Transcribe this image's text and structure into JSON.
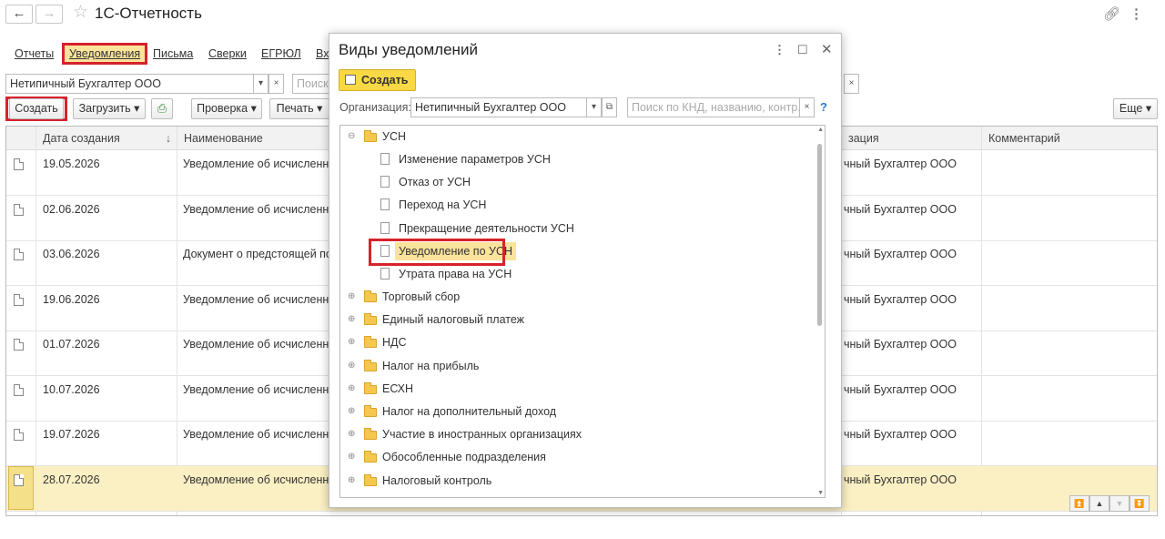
{
  "window": {
    "title": "1С-Отчетность",
    "back_icon": "←",
    "forward_icon": "→"
  },
  "tabs": [
    "Отчеты",
    "Уведомления",
    "Письма",
    "Сверки",
    "ЕГРЮЛ",
    "Вх"
  ],
  "filter": {
    "organization": "Нетипичный Бухгалтер ООО",
    "search_placeholder": "Поиск"
  },
  "toolbar": {
    "create": "Создать",
    "load": "Загрузить",
    "check": "Проверка",
    "print": "Печать",
    "more": "Еще"
  },
  "table": {
    "columns": [
      "Дата создания",
      "Наименование",
      "зация",
      "Комментарий"
    ],
    "rows": [
      {
        "date": "19.05.2026",
        "name": "Уведомление об исчисленных",
        "org": "чный Бухгалтер ООО"
      },
      {
        "date": "02.06.2026",
        "name": "Уведомление об исчисленных",
        "org": "чный Бухгалтер ООО"
      },
      {
        "date": "03.06.2026",
        "name": "Документ о предстоящей пост",
        "org": "чный Бухгалтер ООО"
      },
      {
        "date": "19.06.2026",
        "name": "Уведомление об исчисленных",
        "org": "чный Бухгалтер ООО"
      },
      {
        "date": "01.07.2026",
        "name": "Уведомление об исчисленных",
        "org": "чный Бухгалтер ООО"
      },
      {
        "date": "10.07.2026",
        "name": "Уведомление об исчисленных",
        "org": "чный Бухгалтер ООО"
      },
      {
        "date": "19.07.2026",
        "name": "Уведомление об исчисленных",
        "org": "чный Бухгалтер ООО"
      },
      {
        "date": "28.07.2026",
        "name": "Уведомление об исчисленных",
        "org": "чный Бухгалтер ООО"
      }
    ]
  },
  "modal": {
    "title": "Виды уведомлений",
    "create": "Создать",
    "org_label": "Организация:",
    "org_value": "Нетипичный Бухгалтер ООО",
    "search_placeholder": "Поиск по КНД, названию, контр...",
    "help": "?",
    "tree": {
      "usn": "УСН",
      "usn_children": [
        "Изменение параметров УСН",
        "Отказ от УСН",
        "Переход на УСН",
        "Прекращение деятельности УСН",
        "Уведомление по УСН",
        "Утрата права на УСН"
      ],
      "groups": [
        "Торговый сбор",
        "Единый налоговый платеж",
        "НДС",
        "Налог на прибыль",
        "ЕСХН",
        "Налог на дополнительный доход",
        "Участие в иностранных организациях",
        "Обособленные подразделения",
        "Налоговый контроль"
      ]
    }
  },
  "colors": {
    "highlight": "#d7222b",
    "active_tab": "#fbe39c",
    "selected_row": "#fbf0c4",
    "create_button": "#f8d845"
  }
}
